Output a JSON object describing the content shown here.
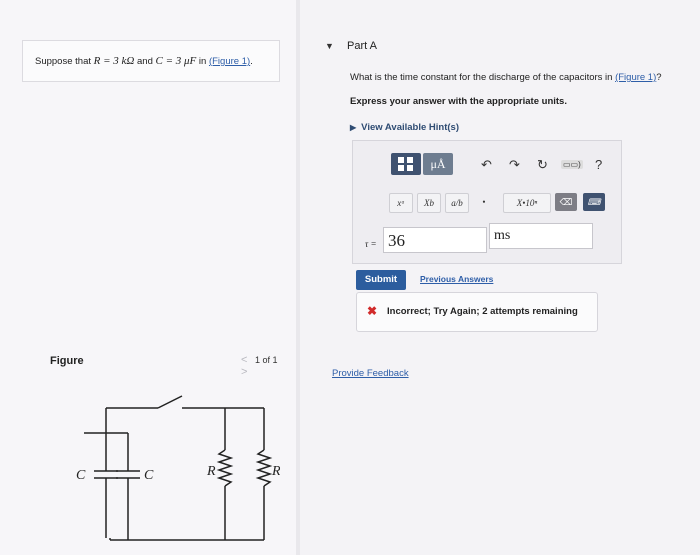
{
  "problem": {
    "prefix": "Suppose that",
    "r_expr": "R = 3 kΩ",
    "and_text": "and",
    "c_expr": "C = 3 μF",
    "in_text": "in",
    "figure_link": "(Figure 1)",
    "suffix": "."
  },
  "part": {
    "toggle_icon": "triangle-down-icon",
    "title": "Part A"
  },
  "question": {
    "text": "What is the time constant for the discharge of the capacitors in",
    "figure_link": "(Figure 1)",
    "suffix": "?"
  },
  "instruction": "Express your answer with the appropriate units.",
  "hints_label": "View Available Hint(s)",
  "toolbar": {
    "units_button": "μÅ",
    "undo": "↶",
    "redo": "↷",
    "reset": "↻",
    "help": "?",
    "keyboard_label": "▭▭)",
    "superscript": "xᵃ",
    "subscript": "Xb",
    "fraction": "a/b",
    "dot": "•",
    "sci": "X•10ⁿ",
    "delete": "⌫"
  },
  "answer": {
    "variable": "τ =",
    "value": "36",
    "unit": "ms"
  },
  "submit_label": "Submit",
  "previous_answers_label": "Previous Answers",
  "feedback": {
    "icon": "x-icon",
    "message": "Incorrect; Try Again; 2 attempts remaining"
  },
  "provide_feedback": "Provide Feedback",
  "figure": {
    "label": "Figure",
    "pager": "1 of 1",
    "prev": "<",
    "next": ">",
    "circuit_labels": {
      "c_left": "C",
      "c_right": "C",
      "r_left": "R",
      "r_right": "R"
    }
  },
  "colors": {
    "accent": "#2c5d9e",
    "link": "#2e5ea8",
    "error": "#d12b2b"
  }
}
